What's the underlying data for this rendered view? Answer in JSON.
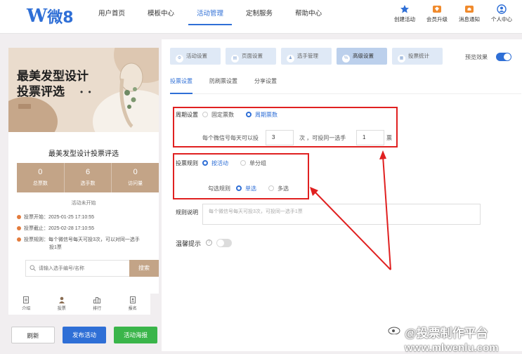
{
  "logo": {
    "mark": "W",
    "text": "微8"
  },
  "nav": [
    {
      "label": "用户首页",
      "active": false
    },
    {
      "label": "模板中心",
      "active": false
    },
    {
      "label": "活动管理",
      "active": true
    },
    {
      "label": "定制服务",
      "active": false
    },
    {
      "label": "帮助中心",
      "active": false
    }
  ],
  "top_actions": [
    {
      "label": "创建活动",
      "icon": "star-icon",
      "color": "#2f6fd6"
    },
    {
      "label": "会员升级",
      "icon": "diamond-icon",
      "color": "#f08a2c"
    },
    {
      "label": "消息通知",
      "icon": "bell-icon",
      "color": "#f08a2c"
    },
    {
      "label": "个人中心",
      "icon": "user-icon",
      "color": "#2f6fd6"
    }
  ],
  "preview": {
    "banner_title_line1": "最美发型设计",
    "banner_title_line2": "投票评选",
    "banner_dots": "• •",
    "card_title": "最美发型设计投票评选",
    "stats": [
      {
        "value": "0",
        "label": "总票数"
      },
      {
        "value": "6",
        "label": "选手数"
      },
      {
        "value": "0",
        "label": "访问量"
      }
    ],
    "status": "活动未开始",
    "info": [
      "投票开始：2025-01-25 17:10:55",
      "投票截止：2025-02-28 17:10:55",
      "投票规则：每个微信号每天可投3次，可以对同一选手",
      "投1票"
    ],
    "search_placeholder": "请输入选手编号/名称",
    "search_button": "搜索",
    "tabbar": [
      {
        "label": "介绍",
        "icon": "doc-icon"
      },
      {
        "label": "投票",
        "icon": "person-icon"
      },
      {
        "label": "排行",
        "icon": "ranking-icon"
      },
      {
        "label": "报名",
        "icon": "signup-icon"
      }
    ],
    "brand_color": "#c3a487"
  },
  "bottom_buttons": {
    "refresh": "刷新",
    "publish": "发布活动",
    "poster": "活动海报"
  },
  "steps": [
    {
      "label": "活动设置",
      "active": false
    },
    {
      "label": "页面设置",
      "active": false
    },
    {
      "label": "选手管理",
      "active": false
    },
    {
      "label": "高级设置",
      "active": true
    },
    {
      "label": "投票统计",
      "active": false
    }
  ],
  "preview_toggle": {
    "label": "预览效果",
    "on": true
  },
  "subtabs": [
    {
      "label": "投票设置",
      "active": true
    },
    {
      "label": "防刷票设置",
      "active": false
    },
    {
      "label": "分享设置",
      "active": false
    }
  ],
  "cycle": {
    "label": "周期设置",
    "option_fixed": "固定票数",
    "option_period": "周期票数",
    "selected": "周期票数",
    "text_prefix": "每个微信号每天可以投",
    "votes_value": "3",
    "text_middle": "次   ，可投同一选手",
    "same_value": "1",
    "text_suffix": "票"
  },
  "rule": {
    "label": "投票规则",
    "option_activity": "按活动",
    "option_group": "单分组",
    "selected": "按活动",
    "check_label": "勾选规则",
    "option_single": "单选",
    "option_multi": "多选",
    "check_selected": "单选"
  },
  "rule_desc": {
    "label": "规则说明",
    "placeholder": "每个微信号每天可投3次，可投同一选手1票"
  },
  "reminder": {
    "label": "温馨提示",
    "on": false
  },
  "watermark": {
    "line1": "@投票制作平台",
    "line2": "www.mlwenlu.com"
  },
  "colors": {
    "accent": "#2f6fd6",
    "annotation_red": "#e02020",
    "green": "#3ab54a"
  }
}
